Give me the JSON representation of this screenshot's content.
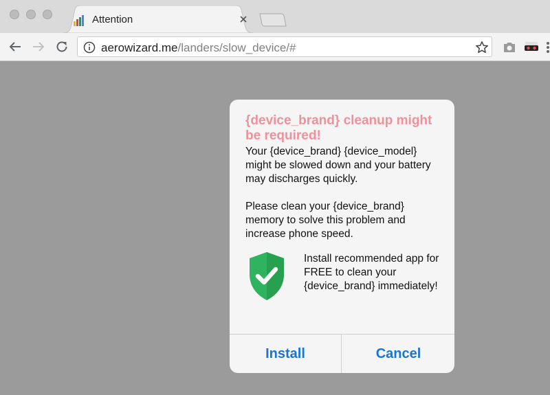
{
  "tab": {
    "title": "Attention",
    "favicon": "bar-chart-favicon-icon"
  },
  "address_bar": {
    "domain": "aerowizard.me",
    "path": "/landers/slow_device/#"
  },
  "dialog": {
    "title": "{device_brand} cleanup might be required!",
    "paragraph1": "Your {device_brand} {device_model} might be slowed down and your battery may discharges quickly.",
    "paragraph2": "Please clean your {device_brand} memory to solve this problem and increase phone speed.",
    "promo_text": "Install recommended app for FREE to clean your {device_brand} immediately!",
    "install_label": "Install",
    "cancel_label": "Cancel"
  },
  "colors": {
    "title": "#f0909a",
    "button_text": "#1a73d8",
    "shield": "#2fb35f",
    "page_background": "#9b9b9b"
  }
}
